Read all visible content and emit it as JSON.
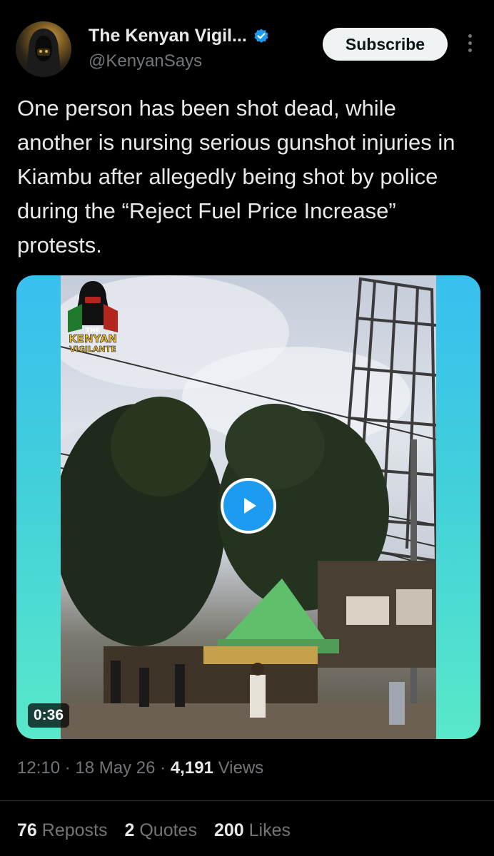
{
  "author": {
    "name": "The Kenyan Vigil...",
    "handle": "@KenyanSays",
    "avatar_icon": "hooded-figure-avatar",
    "verified_icon": "verified-badge-icon"
  },
  "actions": {
    "subscribe_label": "Subscribe",
    "more_icon": "more-vertical-icon"
  },
  "tweet": {
    "text": "One person has been shot dead, while another is nursing serious gunshot injuries in Kiambu after allegedly being shot by police during the “Reject Fuel Price Increase” protests."
  },
  "media": {
    "type": "video",
    "duration": "0:36",
    "play_icon": "play-icon",
    "watermark_lines": [
      "THE",
      "KENYAN",
      "VIGILANTE"
    ]
  },
  "meta": {
    "time": "12:10",
    "sep1": "·",
    "date": "18 May 26",
    "sep2": "·",
    "views_count": "4,191",
    "views_label": "Views"
  },
  "stats": {
    "reposts_count": "76",
    "reposts_label": "Reposts",
    "quotes_count": "2",
    "quotes_label": "Quotes",
    "likes_count": "200",
    "likes_label": "Likes"
  },
  "colors": {
    "background": "#000000",
    "text": "#e7e9ea",
    "secondary": "#71767b",
    "accent": "#1d9bf0",
    "subscribe_bg": "#eff3f4"
  }
}
